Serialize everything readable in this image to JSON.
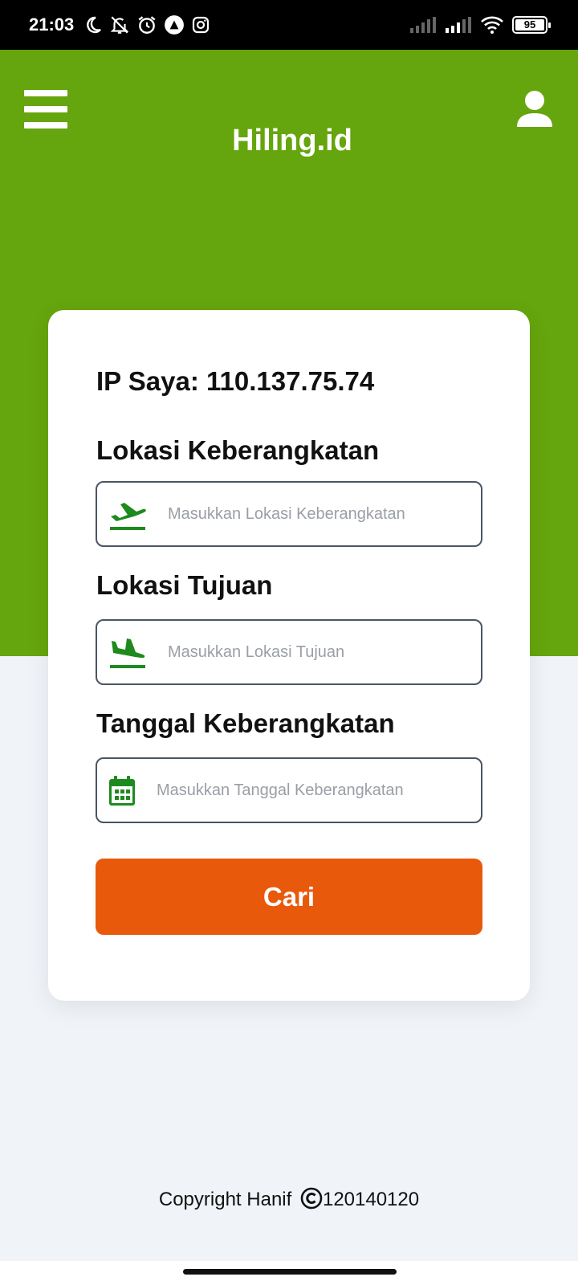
{
  "status_bar": {
    "time": "21:03",
    "battery": "95",
    "icons": [
      "moon-icon",
      "bell-off-icon",
      "alarm-icon",
      "app-icon",
      "instagram-icon",
      "signal-icon",
      "signal-icon",
      "wifi-icon",
      "battery-icon"
    ]
  },
  "header": {
    "title": "Hiling.id",
    "menu_icon": "hamburger-menu-icon",
    "profile_icon": "user-icon",
    "color": "#65a50d"
  },
  "form": {
    "ip_text": "IP Saya: 110.137.75.74",
    "departure": {
      "label": "Lokasi Keberangkatan",
      "placeholder": "Masukkan Lokasi Keberangkatan",
      "value": "",
      "icon": "plane-departure-icon"
    },
    "destination": {
      "label": "Lokasi Tujuan",
      "placeholder": "Masukkan Lokasi Tujuan",
      "value": "",
      "icon": "plane-arrival-icon"
    },
    "date": {
      "label": "Tanggal Keberangkatan",
      "placeholder": "Masukkan Tanggal Keberangkatan",
      "value": "",
      "icon": "calendar-icon"
    },
    "search_button": "Cari",
    "accent_color": "#e8590c",
    "icon_color": "#1e8a1e"
  },
  "footer": {
    "copyright_prefix": "Copyright Hanif",
    "copyright_suffix": "120140120"
  }
}
